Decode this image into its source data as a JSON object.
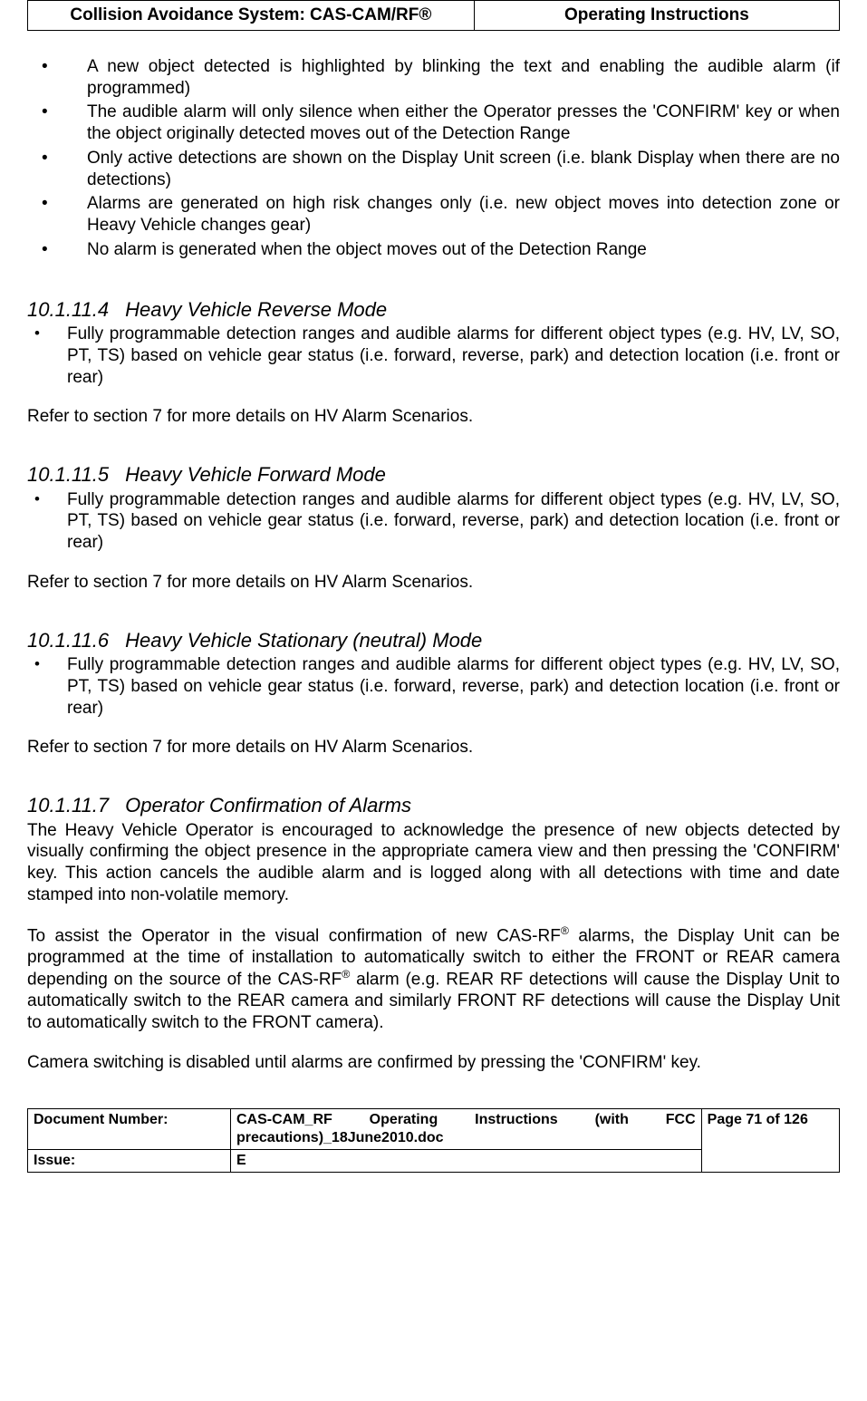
{
  "header": {
    "left": "Collision Avoidance System: CAS-CAM/RF®",
    "right": "Operating Instructions"
  },
  "topBullets": [
    "A new object detected is highlighted by blinking the text and enabling the audible alarm (if programmed)",
    "The audible alarm will only silence when either the Operator presses the 'CONFIRM' key or when the object originally detected moves out of the Detection Range",
    "Only active detections are shown on the Display Unit screen (i.e. blank Display when there are no detections)",
    "Alarms are generated on high risk changes only (i.e. new object moves into detection zone or Heavy Vehicle changes gear)",
    "No alarm is generated when the object moves out of the Detection Range"
  ],
  "sections": [
    {
      "num": "10.1.11.4",
      "title": "Heavy Vehicle Reverse Mode",
      "bullets": [
        "Fully programmable detection ranges and audible alarms for different object types (e.g. HV, LV, SO, PT, TS) based on vehicle gear status (i.e. forward, reverse, park) and detection location (i.e. front or rear)"
      ],
      "refer": "Refer to section 7 for more details on HV Alarm Scenarios."
    },
    {
      "num": "10.1.11.5",
      "title": "Heavy Vehicle Forward Mode",
      "bullets": [
        "Fully programmable detection ranges and audible alarms for different object types (e.g. HV, LV, SO, PT, TS) based on vehicle gear status (i.e. forward, reverse, park) and detection location (i.e. front or rear)"
      ],
      "refer": "Refer to section 7 for more details on HV Alarm Scenarios."
    },
    {
      "num": "10.1.11.6",
      "title": "Heavy Vehicle Stationary (neutral) Mode",
      "bullets": [
        "Fully programmable detection ranges and audible alarms for different object types (e.g. HV, LV, SO, PT, TS) based on vehicle gear status (i.e. forward, reverse, park) and detection location (i.e. front or rear)"
      ],
      "refer": "Refer to section 7 for more details on HV Alarm Scenarios."
    }
  ],
  "section7": {
    "num": "10.1.11.7",
    "title": "Operator Confirmation of Alarms",
    "p1": "The Heavy Vehicle Operator is encouraged to acknowledge the presence of new objects detected by visually confirming the object presence in the appropriate camera view and then pressing the 'CONFIRM' key. This action cancels the audible alarm and is logged along with all detections with time and date stamped into non-volatile memory.",
    "p2a": "To assist the Operator in the visual confirmation of new CAS-RF",
    "p2b": " alarms, the Display Unit can be programmed at the time of installation to automatically switch to either the FRONT or REAR camera depending on the source of the CAS-RF",
    "p2c": " alarm (e.g. REAR RF detections will cause the Display Unit to automatically switch to the REAR camera and similarly FRONT RF detections will cause the Display Unit to automatically switch to the FRONT camera).",
    "p3": "Camera switching is disabled until alarms are confirmed by pressing the 'CONFIRM' key."
  },
  "footer": {
    "docNumLabel": "Document Number:",
    "docNumValue": "CAS-CAM_RF Operating Instructions (with FCC precautions)_18June2010.doc",
    "issueLabel": "Issue:",
    "issueValue": "E",
    "pageText": "Page 71 of  126"
  },
  "reg": "®"
}
